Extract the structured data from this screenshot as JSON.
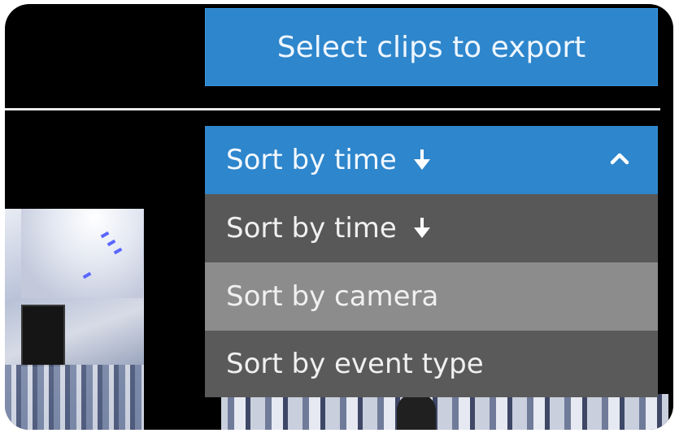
{
  "export": {
    "button_label": "Select clips to export"
  },
  "sort": {
    "selected_label": "Sort by time",
    "selected_direction_icon": "arrow-down-icon",
    "toggle_icon": "chevron-up-icon",
    "options": [
      {
        "label": "Sort by time",
        "icon": "arrow-down-icon",
        "state": "normal"
      },
      {
        "label": "Sort by camera",
        "state": "hover"
      },
      {
        "label": "Sort by event type",
        "state": "normal"
      }
    ]
  },
  "colors": {
    "accent": "#2e86cc",
    "menu_bg": "#585858",
    "menu_hover_bg": "#8c8c8c",
    "background": "#000000"
  }
}
